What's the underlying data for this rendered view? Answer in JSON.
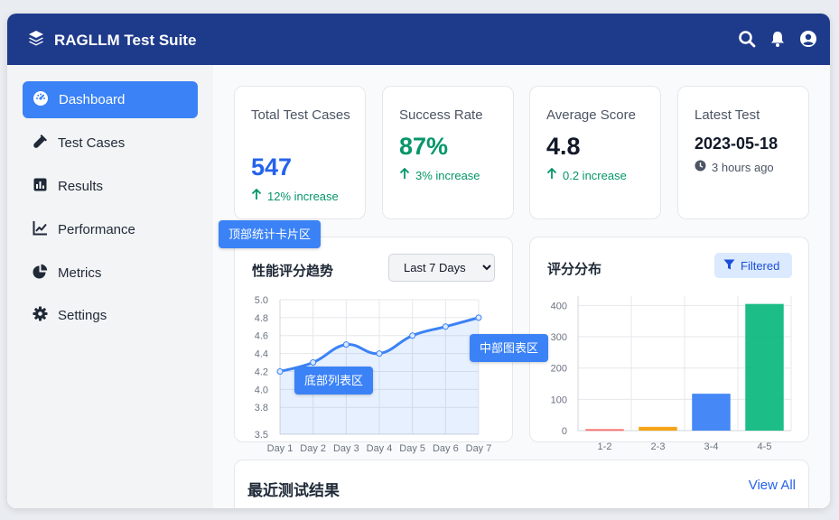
{
  "app": {
    "title": "RAGLLM Test Suite"
  },
  "topbar": {
    "icons": [
      "search-icon",
      "bell-icon",
      "user-circle-icon"
    ]
  },
  "sidebar": {
    "items": [
      {
        "label": "Dashboard",
        "icon": "dashboard-icon",
        "active": true
      },
      {
        "label": "Test Cases",
        "icon": "flask-icon",
        "active": false
      },
      {
        "label": "Results",
        "icon": "bar-chart-icon",
        "active": false
      },
      {
        "label": "Performance",
        "icon": "line-chart-icon",
        "active": false
      },
      {
        "label": "Metrics",
        "icon": "pie-chart-icon",
        "active": false
      },
      {
        "label": "Settings",
        "icon": "gear-icon",
        "active": false
      }
    ]
  },
  "stats": [
    {
      "title": "Total Test Cases",
      "value": "547",
      "sub": "12% increase",
      "value_color": "#2563eb"
    },
    {
      "title": "Success Rate",
      "value": "87%",
      "sub": "3% increase",
      "value_color": "#059669"
    },
    {
      "title": "Average Score",
      "value": "4.8",
      "sub": "0.2 increase",
      "value_color": "#111827"
    },
    {
      "title": "Latest Test",
      "value": "2023-05-18",
      "sub": "3 hours ago",
      "value_color": "#111827"
    }
  ],
  "tooltips": {
    "top": "顶部统计卡片区",
    "middle": "中部图表区",
    "bottom": "底部列表区"
  },
  "performance": {
    "title": "性能评分趋势",
    "range_selected": "Last 7 Days"
  },
  "distribution": {
    "title": "评分分布",
    "filter_label": "Filtered"
  },
  "recent": {
    "title": "最近测试结果",
    "view_all": "View All"
  },
  "chart_data": [
    {
      "type": "area",
      "x": [
        "Day 1",
        "Day 2",
        "Day 3",
        "Day 4",
        "Day 5",
        "Day 6",
        "Day 7"
      ],
      "values": [
        4.2,
        4.3,
        4.5,
        4.4,
        4.6,
        4.7,
        4.8
      ],
      "yticks": [
        "3.5",
        "3.8",
        "4.0",
        "4.2",
        "4.4",
        "4.6",
        "4.8",
        "5.0"
      ],
      "ylim": [
        3.5,
        5.0
      ],
      "grid": true,
      "color": "#3b82f6"
    },
    {
      "type": "bar",
      "categories": [
        "1-2",
        "2-3",
        "3-4",
        "4-5"
      ],
      "values": [
        5,
        12,
        118,
        405
      ],
      "yticks": [
        "0",
        "100",
        "200",
        "300",
        "400"
      ],
      "ylim": [
        0,
        430
      ],
      "grid": true,
      "colors": [
        "#f87171",
        "#f59e0b",
        "#3b82f6",
        "#10b981"
      ]
    }
  ]
}
